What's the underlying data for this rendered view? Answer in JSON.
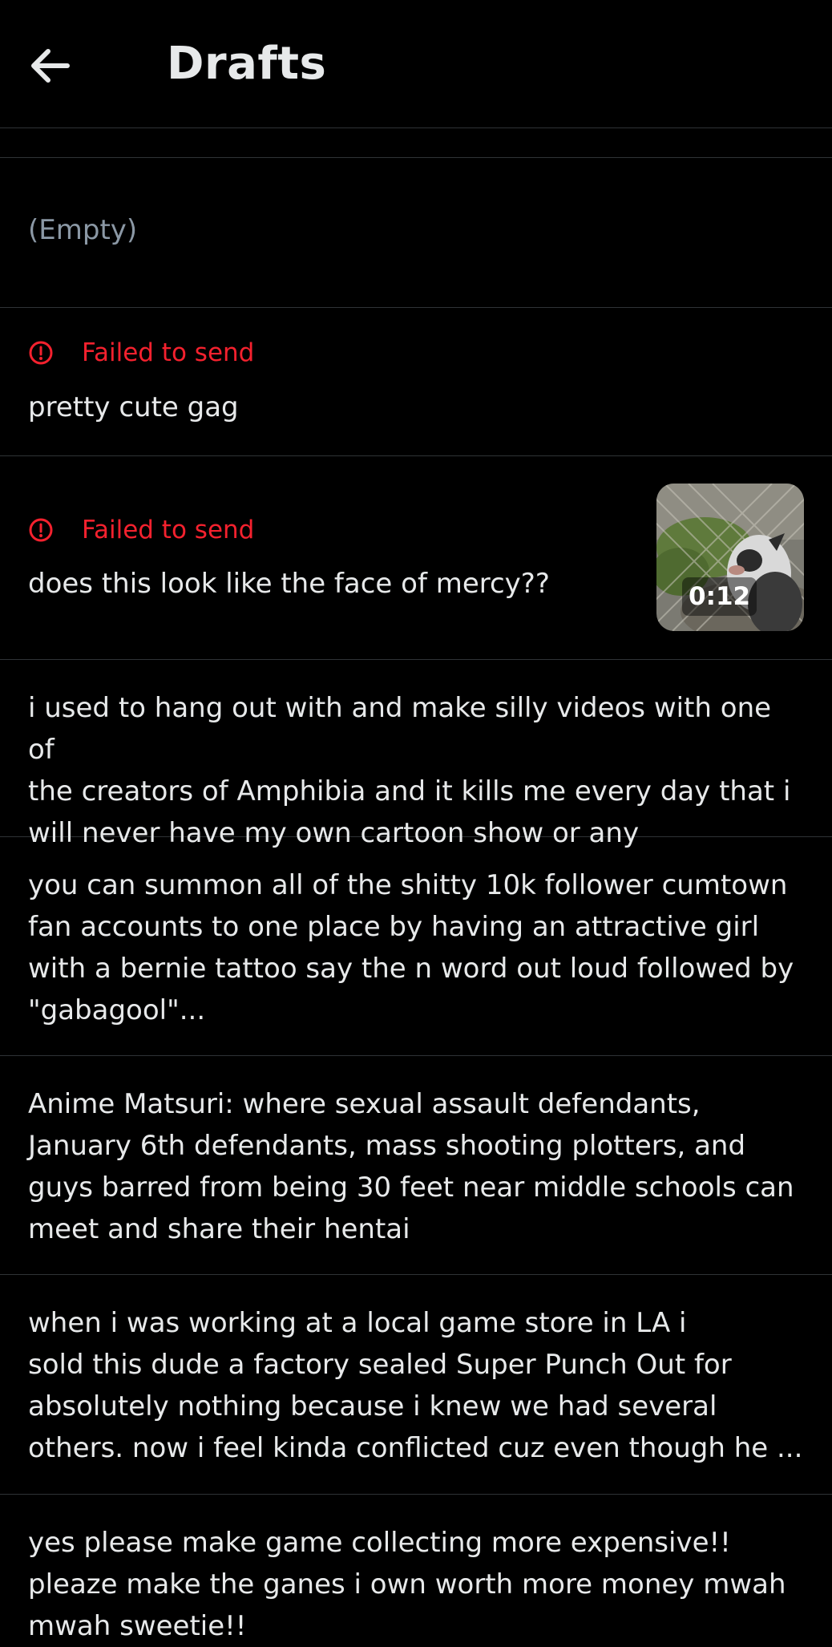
{
  "header": {
    "title": "Drafts",
    "back_icon": "arrow-left-icon"
  },
  "colors": {
    "background": "#000000",
    "text": "#e7e9ea",
    "muted": "#8b98a5",
    "error": "#f4212e",
    "divider": "#2f3336"
  },
  "drafts": [
    {
      "text": "(Empty)"
    },
    {
      "status": "Failed to send",
      "status_icon": "alert-circle-icon",
      "text": "pretty cute gag"
    },
    {
      "status": "Failed to send",
      "status_icon": "alert-circle-icon",
      "text": "does this look like the face of mercy??",
      "media": {
        "type": "video",
        "duration": "0:12"
      }
    },
    {
      "text": "i used to hang out with and make silly videos with one of\nthe creators of Amphibia and it kills me every day that i\nwill never have my own cartoon show or any"
    },
    {
      "text": "you can summon all of the shitty 10k follower cumtown\nfan accounts to one place by having an attractive girl\nwith a bernie tattoo say the n word out loud followed by\n\"gabagool\"..."
    },
    {
      "text": "Anime Matsuri: where sexual assault defendants,\nJanuary 6th defendants, mass shooting plotters, and\nguys barred from being 30 feet near middle schools can\nmeet and share their hentai"
    },
    {
      "text": "when i was working at a local game store in LA i\nsold this dude a factory sealed Super Punch Out for\nabsolutely nothing because i knew we had several\nothers. now i feel kinda conflicted cuz even though he ..."
    },
    {
      "text": "yes please make game collecting more expensive!!\npleaze make the ganes i own worth more money mwah\nmwah sweetie!!"
    }
  ]
}
